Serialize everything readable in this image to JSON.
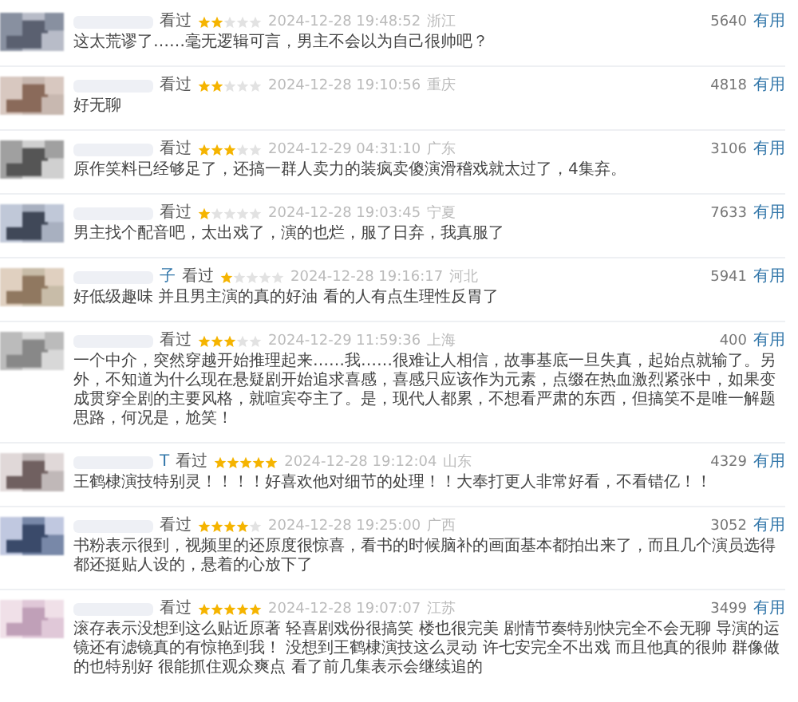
{
  "comments": [
    {
      "status": "看过",
      "stars": 2,
      "time": "2024-12-28 19:48:52",
      "region": "浙江",
      "votes": "5640",
      "useful": "有用",
      "text": "这太荒谬了……毫无逻辑可言，男主不会以为自己很帅吧？"
    },
    {
      "status": "看过",
      "stars": 2,
      "time": "2024-12-28 19:10:56",
      "region": "重庆",
      "votes": "4818",
      "useful": "有用",
      "text": "好无聊"
    },
    {
      "status": "看过",
      "stars": 3,
      "time": "2024-12-29 04:31:10",
      "region": "广东",
      "votes": "3106",
      "useful": "有用",
      "text": "原作笑料已经够足了，还搞一群人卖力的装疯卖傻演滑稽戏就太过了，4集弃。"
    },
    {
      "status": "看过",
      "stars": 1,
      "time": "2024-12-28 19:03:45",
      "region": "宁夏",
      "votes": "7633",
      "useful": "有用",
      "text": "男主找个配音吧，太出戏了，演的也烂，服了日弃，我真服了"
    },
    {
      "user": "子",
      "status": "看过",
      "stars": 1,
      "time": "2024-12-28 19:16:17",
      "region": "河北",
      "votes": "5941",
      "useful": "有用",
      "text": "好低级趣味 并且男主演的真的好油 看的人有点生理性反胃了"
    },
    {
      "status": "看过",
      "stars": 3,
      "time": "2024-12-29 11:59:36",
      "region": "上海",
      "votes": "400",
      "useful": "有用",
      "text": "一个中介，突然穿越开始推理起来……我……很难让人相信，故事基底一旦失真，起始点就输了。另外，不知道为什么现在悬疑剧开始追求喜感，喜感只应该作为元素，点缀在热血激烈紧张中，如果变成贯穿全剧的主要风格，就喧宾夺主了。是，现代人都累，不想看严肃的东西，但搞笑不是唯一解题思路，何况是，尬笑！"
    },
    {
      "user": "T",
      "status": "看过",
      "stars": 5,
      "time": "2024-12-28 19:12:04",
      "region": "山东",
      "votes": "4329",
      "useful": "有用",
      "text": "王鹤棣演技特别灵！！！！好喜欢他对细节的处理！！大奉打更人非常好看，不看错亿！！"
    },
    {
      "status": "看过",
      "stars": 4,
      "time": "2024-12-28 19:25:00",
      "region": "广西",
      "votes": "3052",
      "useful": "有用",
      "text": "书粉表示很到，视频里的还原度很惊喜，看书的时候脑补的画面基本都拍出来了，而且几个演员选得都还挺贴人设的，悬着的心放下了"
    },
    {
      "status": "看过",
      "stars": 5,
      "time": "2024-12-28 19:07:07",
      "region": "江苏",
      "votes": "3499",
      "useful": "有用",
      "text": "滚存表示没想到这么贴近原著 轻喜剧戏份很搞笑 楼也很完美 剧情节奏特别快完全不会无聊 导演的运镜还有滤镜真的有惊艳到我！ 没想到王鹤棣演技这么灵动 许七安完全不出戏 而且他真的很帅 群像做的也特别好 很能抓住观众爽点 看了前几集表示会继续追的"
    }
  ]
}
